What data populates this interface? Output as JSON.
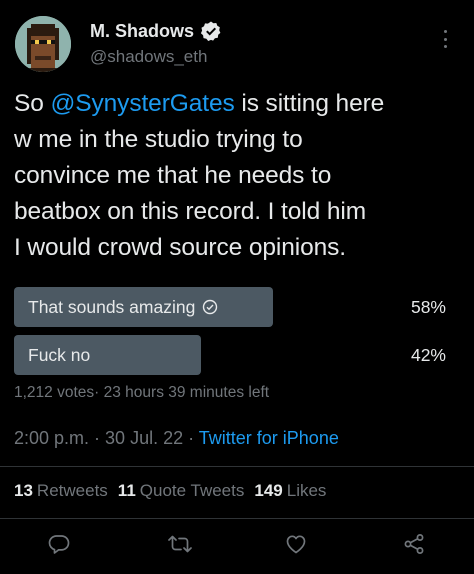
{
  "author": {
    "display_name": "M. Shadows",
    "handle": "@shadows_eth",
    "avatar_icon": "pixel-avatar-icon",
    "verified_icon": "verified-badge-icon"
  },
  "tweet": {
    "lines": [
      {
        "before": "So ",
        "mention": "@SynysterGates",
        "after": " is sitting here"
      },
      {
        "text": "w me in the studio trying to"
      },
      {
        "text": "convince me that he needs to"
      },
      {
        "text": "beatbox on this record.  I told him"
      },
      {
        "text": "I would crowd source opinions."
      }
    ]
  },
  "poll": {
    "options": [
      {
        "label": "That sounds amazing",
        "percent_text": "58%",
        "percent": 58,
        "selected": true
      },
      {
        "label": "Fuck no",
        "percent_text": "42%",
        "percent": 42,
        "selected": false
      }
    ],
    "votes": "1,212 votes",
    "time_left": "23 hours 39 minutes left"
  },
  "meta": {
    "time": "2:00 p.m.",
    "date": "30 Jul. 22",
    "source": "Twitter for iPhone"
  },
  "stats": {
    "retweets_count": "13",
    "retweets_label": "Retweets",
    "quotes_count": "11",
    "quotes_label": "Quote Tweets",
    "likes_count": "149",
    "likes_label": "Likes"
  },
  "actions": [
    "reply-icon",
    "retweet-icon",
    "like-icon",
    "share-icon"
  ],
  "colors": {
    "background": "#000000",
    "text": "#e7e9ea",
    "secondary": "#71767b",
    "accent": "#1d9bf0",
    "poll_bar": "#4c5963"
  }
}
